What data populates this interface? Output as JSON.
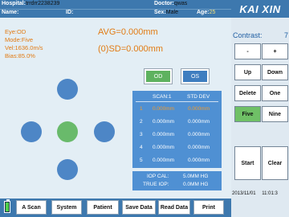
{
  "header": {
    "hospital_label": "Hospital:",
    "hospital_value": "trrdrr2238239",
    "doctor_label": "Doctor:",
    "doctor_value": "qwas",
    "name_label": "Name:",
    "id_label": "ID:",
    "sex_label": "Sex:",
    "sex_value": "Male",
    "age_label": "Age:",
    "age_value": "25"
  },
  "brand": "KAI XIN",
  "info": {
    "eye": "Eye:OD",
    "mode": "Mode:Five",
    "vel": "Vel:1636.0m/s",
    "bias": "Bias:85.0%"
  },
  "measure": {
    "avg": "AVG=0.000mm",
    "sd": "(0)SD=0.000mm"
  },
  "eye_buttons": {
    "od": "OD",
    "os": "OS"
  },
  "scan_table": {
    "col_scan": "SCAN:1",
    "col_std": "STD DEV",
    "rows": [
      {
        "n": "1",
        "scan": "0.000mm",
        "std": "0.000mm"
      },
      {
        "n": "2",
        "scan": "0.000mm",
        "std": "0.000mm"
      },
      {
        "n": "3",
        "scan": "0.000mm",
        "std": "0.000mm"
      },
      {
        "n": "4",
        "scan": "0.000mm",
        "std": "0.000mm"
      },
      {
        "n": "5",
        "scan": "0.000mm",
        "std": "0.000mm"
      }
    ]
  },
  "iop": {
    "cal_label": "IOP CAL:",
    "cal_value": "5.0MM HG",
    "true_label": "TRUE IOP:",
    "true_value": "0.0MM HG"
  },
  "panel": {
    "contrast_label": "Contrast:",
    "contrast_value": "7",
    "minus": "-",
    "plus": "+",
    "up": "Up",
    "down": "Down",
    "delete": "Delete",
    "one": "One",
    "five": "Five",
    "nine": "Nine",
    "start": "Start",
    "clear": "Clear",
    "date": "2013/11/01",
    "time": "11:01:3"
  },
  "bottom": {
    "ascan": "A Scan",
    "system": "System",
    "patient": "Patient",
    "save": "Save Data",
    "read": "Read Data",
    "print": "Print"
  },
  "colors": {
    "header_blue": "#3d78ae",
    "accent_orange": "#e27b14",
    "table_blue": "#4f90d3",
    "active_green": "#69ba6b"
  }
}
